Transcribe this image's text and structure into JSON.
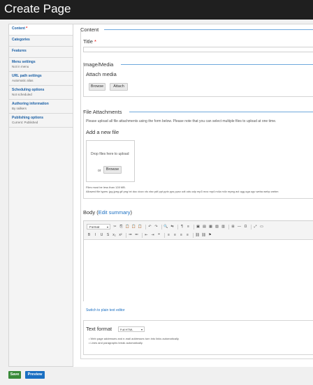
{
  "header": {
    "title": "Create Page"
  },
  "vtabs": [
    {
      "label": "Content",
      "summary": "",
      "required": "*"
    },
    {
      "label": "Categories",
      "summary": ""
    },
    {
      "label": "Features",
      "summary": ""
    },
    {
      "label": "Menu settings",
      "summary": "Not in menu"
    },
    {
      "label": "URL path settings",
      "summary": "Automatic alias"
    },
    {
      "label": "Scheduling options",
      "summary": "Not scheduled"
    },
    {
      "label": "Authoring information",
      "summary": "By railkers"
    },
    {
      "label": "Publishing options",
      "summary": "Current: Published"
    }
  ],
  "content_fieldset": {
    "legend": "Content",
    "title_label": "Title",
    "title_required": "*",
    "title_value": ""
  },
  "image_media": {
    "legend": "Image/Media",
    "attach_label": "Attach media",
    "browse_label": "Browse",
    "attach_button": "Attach"
  },
  "file_attachments": {
    "legend": "File Attachments",
    "instructions": "Please upload all file attachments using the form below. Please note that you can select multiple files to upload at one time.",
    "add_label": "Add a new file",
    "drop_text": "Drop files here to upload",
    "or_text": "or",
    "browse_label": "Browse",
    "size_note": "Files must be less than 128 MB.",
    "types_note": "Allowed file types: jpg jpeg gif png txt doc docx xls xlsx pdf ppt pptx pps ppsx odt ods odp mp3 mov mp4 m4a m4v mpeg avi ogg oga ogv weba webp webm"
  },
  "body_field": {
    "label": "Body",
    "open_paren": "(",
    "edit_summary_link": "Edit summary",
    "close_paren": ")",
    "format_dropdown": "Format",
    "switch_link": "Switch to plain text editor"
  },
  "toolbar": {
    "row1": [
      "✂",
      "⎘",
      "📋",
      "📋",
      "📋",
      "|",
      "↶",
      "↷",
      "|",
      "🔍",
      "⇆",
      "|",
      "¶",
      "≡",
      "|",
      "▣",
      "▤",
      "▦",
      "▧",
      "▥",
      "|",
      "⊞",
      "―",
      "Ω",
      "|",
      "⤢",
      "▭"
    ],
    "row2": [
      "B",
      "I",
      "U",
      "S",
      "x₂",
      "x²",
      "|",
      "≔",
      "≕",
      "|",
      "⇤",
      "⇥",
      "❝",
      "|",
      "≡",
      "≡",
      "≡",
      "≡",
      "|",
      "⛓",
      "⛓",
      "⚑"
    ]
  },
  "text_format": {
    "label": "Text format",
    "selected": "Full HTML",
    "tips": [
      "Web page addresses and e-mail addresses turn into links automatically.",
      "Lines and paragraphs break automatically."
    ]
  },
  "actions": {
    "save_label": "Save",
    "preview_label": "Preview",
    "save_color": "#3a8a3a",
    "preview_color": "#1a6fc2"
  }
}
